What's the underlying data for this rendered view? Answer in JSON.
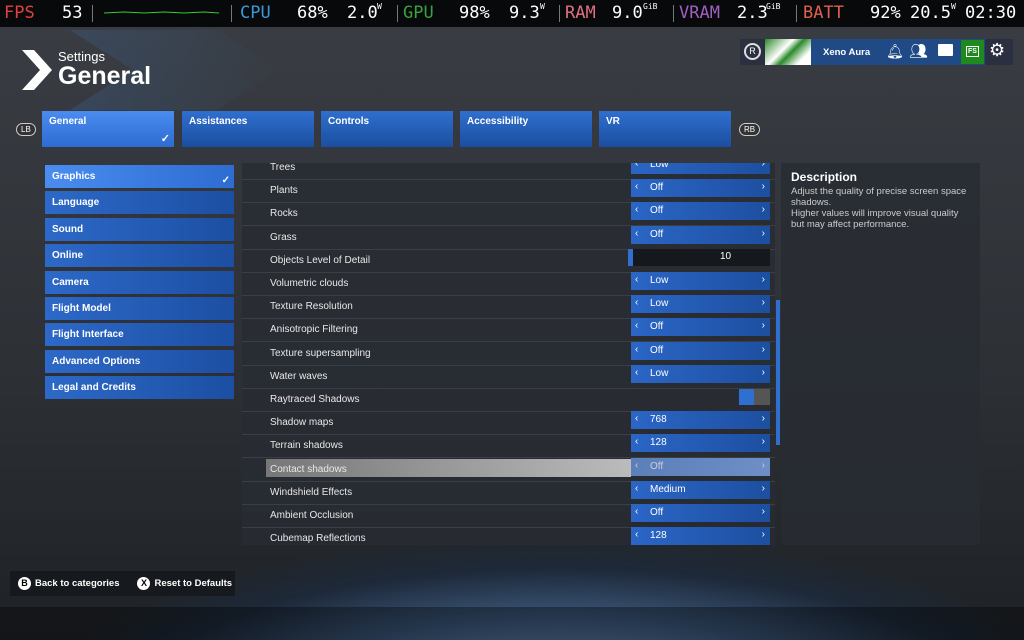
{
  "osd": {
    "fps_label": "FPS",
    "fps": "53",
    "cpu_label": "CPU",
    "cpu_load": "68%",
    "cpu_power": "2.0",
    "gpu_label": "GPU",
    "gpu_load": "98%",
    "gpu_power": "9.3",
    "ram_label": "RAM",
    "ram": "9.0",
    "vram_label": "VRAM",
    "vram": "2.3",
    "gib": "GiB",
    "w": "W",
    "batt_label": "BATT",
    "batt": "92%",
    "batt_power": "20.5",
    "time": "02:30",
    "colors": {
      "fps": "#e04040",
      "cpu": "#3a9ad8",
      "gpu": "#3aa040",
      "ram": "#e07080",
      "vram": "#a060c0",
      "batt": "#e06050"
    }
  },
  "header": {
    "section": "Settings",
    "title": "General"
  },
  "user": {
    "name": "Xeno Aura",
    "store_label": "FS"
  },
  "tabs": {
    "lb": "LB",
    "rb": "RB",
    "items": [
      "General",
      "Assistances",
      "Controls",
      "Accessibility",
      "VR"
    ]
  },
  "menu": [
    "Graphics",
    "Language",
    "Sound",
    "Online",
    "Camera",
    "Flight Model",
    "Flight Interface",
    "Advanced Options",
    "Legal and Credits"
  ],
  "rows": [
    {
      "label": "Trees",
      "value": "Low",
      "type": "select"
    },
    {
      "label": "Plants",
      "value": "Off",
      "type": "select"
    },
    {
      "label": "Rocks",
      "value": "Off",
      "type": "select"
    },
    {
      "label": "Grass",
      "value": "Off",
      "type": "select"
    },
    {
      "label": "Objects Level of Detail",
      "value": "10",
      "type": "slider"
    },
    {
      "label": "Volumetric clouds",
      "value": "Low",
      "type": "select"
    },
    {
      "label": "Texture Resolution",
      "value": "Low",
      "type": "select"
    },
    {
      "label": "Anisotropic Filtering",
      "value": "Off",
      "type": "select"
    },
    {
      "label": "Texture supersampling",
      "value": "Off",
      "type": "select"
    },
    {
      "label": "Water waves",
      "value": "Low",
      "type": "select"
    },
    {
      "label": "Raytraced Shadows",
      "value": "",
      "type": "toggle"
    },
    {
      "label": "Shadow maps",
      "value": "768",
      "type": "select"
    },
    {
      "label": "Terrain shadows",
      "value": "128",
      "type": "select"
    },
    {
      "label": "Contact shadows",
      "value": "Off",
      "type": "select",
      "selected": true
    },
    {
      "label": "Windshield Effects",
      "value": "Medium",
      "type": "select"
    },
    {
      "label": "Ambient Occlusion",
      "value": "Off",
      "type": "select"
    },
    {
      "label": "Cubemap Reflections",
      "value": "128",
      "type": "select"
    }
  ],
  "description": {
    "title": "Description",
    "text1": "Adjust the quality of precise screen space shadows.",
    "text2": "Higher values will improve visual quality but may affect performance."
  },
  "footer": {
    "back_key": "B",
    "back": "Back to categories",
    "reset_key": "X",
    "reset": "Reset to Defaults"
  }
}
